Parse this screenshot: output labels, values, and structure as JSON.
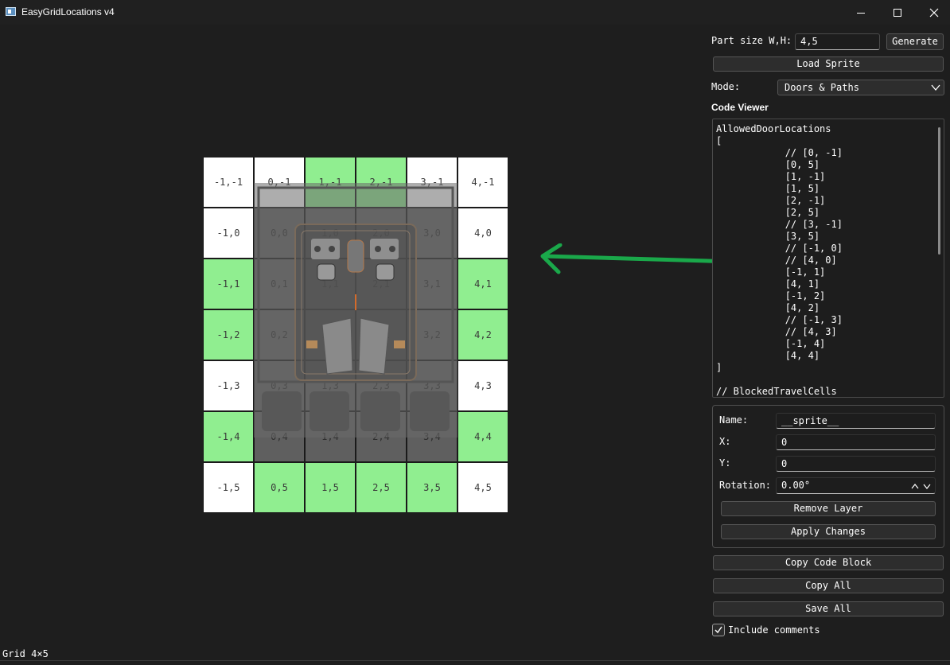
{
  "window": {
    "title": "EasyGridLocations v4"
  },
  "toolbar": {
    "part_size_label": "Part size W,H:",
    "part_size_value": "4,5",
    "generate_label": "Generate",
    "load_sprite_label": "Load Sprite",
    "mode_label": "Mode:",
    "mode_value": "Doors & Paths"
  },
  "code_viewer": {
    "title": "Code Viewer",
    "lines": [
      "AllowedDoorLocations",
      "[",
      "            // [0, -1]",
      "            [0, 5]",
      "            [1, -1]",
      "            [1, 5]",
      "            [2, -1]",
      "            [2, 5]",
      "            // [3, -1]",
      "            [3, 5]",
      "            // [-1, 0]",
      "            // [4, 0]",
      "            [-1, 1]",
      "            [4, 1]",
      "            [-1, 2]",
      "            [4, 2]",
      "            // [-1, 3]",
      "            // [4, 3]",
      "            [-1, 4]",
      "            [4, 4]",
      "]",
      "",
      "// BlockedTravelCells"
    ]
  },
  "layer": {
    "name_label": "Name:",
    "name_value": "__sprite__",
    "x_label": "X:",
    "x_value": "0",
    "y_label": "Y:",
    "y_value": "0",
    "rotation_label": "Rotation:",
    "rotation_value": "0.00°",
    "remove_label": "Remove Layer",
    "apply_label": "Apply Changes"
  },
  "actions": {
    "copy_code_block": "Copy Code Block",
    "copy_all": "Copy All",
    "save_all": "Save All",
    "include_comments_label": "Include comments",
    "include_comments_checked": true
  },
  "grid": {
    "rows": [
      [
        {
          "label": "-1,-1",
          "state": "white"
        },
        {
          "label": "0,-1",
          "state": "white"
        },
        {
          "label": "1,-1",
          "state": "green"
        },
        {
          "label": "2,-1",
          "state": "green"
        },
        {
          "label": "3,-1",
          "state": "white"
        },
        {
          "label": "4,-1",
          "state": "white"
        }
      ],
      [
        {
          "label": "-1,0",
          "state": "white"
        },
        {
          "label": "0,0",
          "state": "sprite"
        },
        {
          "label": "1,0",
          "state": "sprite"
        },
        {
          "label": "2,0",
          "state": "sprite"
        },
        {
          "label": "3,0",
          "state": "sprite"
        },
        {
          "label": "4,0",
          "state": "white"
        }
      ],
      [
        {
          "label": "-1,1",
          "state": "green"
        },
        {
          "label": "0,1",
          "state": "sprite"
        },
        {
          "label": "1,1",
          "state": "sprite"
        },
        {
          "label": "2,1",
          "state": "sprite"
        },
        {
          "label": "3,1",
          "state": "sprite"
        },
        {
          "label": "4,1",
          "state": "green"
        }
      ],
      [
        {
          "label": "-1,2",
          "state": "green"
        },
        {
          "label": "0,2",
          "state": "sprite"
        },
        {
          "label": "1,2",
          "state": "sprite"
        },
        {
          "label": "2,2",
          "state": "sprite"
        },
        {
          "label": "3,2",
          "state": "sprite"
        },
        {
          "label": "4,2",
          "state": "green"
        }
      ],
      [
        {
          "label": "-1,3",
          "state": "white"
        },
        {
          "label": "0,3",
          "state": "sprite"
        },
        {
          "label": "1,3",
          "state": "sprite"
        },
        {
          "label": "2,3",
          "state": "sprite"
        },
        {
          "label": "3,3",
          "state": "sprite"
        },
        {
          "label": "4,3",
          "state": "white"
        }
      ],
      [
        {
          "label": "-1,4",
          "state": "green"
        },
        {
          "label": "0,4",
          "state": "sprite"
        },
        {
          "label": "1,4",
          "state": "sprite"
        },
        {
          "label": "2,4",
          "state": "sprite"
        },
        {
          "label": "3,4",
          "state": "sprite"
        },
        {
          "label": "4,4",
          "state": "green"
        }
      ],
      [
        {
          "label": "-1,5",
          "state": "white"
        },
        {
          "label": "0,5",
          "state": "green"
        },
        {
          "label": "1,5",
          "state": "green"
        },
        {
          "label": "2,5",
          "state": "green"
        },
        {
          "label": "3,5",
          "state": "green"
        },
        {
          "label": "4,5",
          "state": "white"
        }
      ]
    ]
  },
  "status": {
    "text": "Grid 4×5"
  },
  "colors": {
    "green_cell": "#90ee90",
    "white_cell": "#ffffff",
    "arrow": "#1aa84a",
    "background": "#1e1e1e"
  },
  "icons": {
    "app": "app-window-icon",
    "minimize": "minimize-icon",
    "maximize": "maximize-icon",
    "close": "close-icon",
    "dropdown": "chevron-down-icon",
    "spin": "spin-up-down-icon",
    "check": "check-icon",
    "arrow": "double-headed-arrow"
  }
}
